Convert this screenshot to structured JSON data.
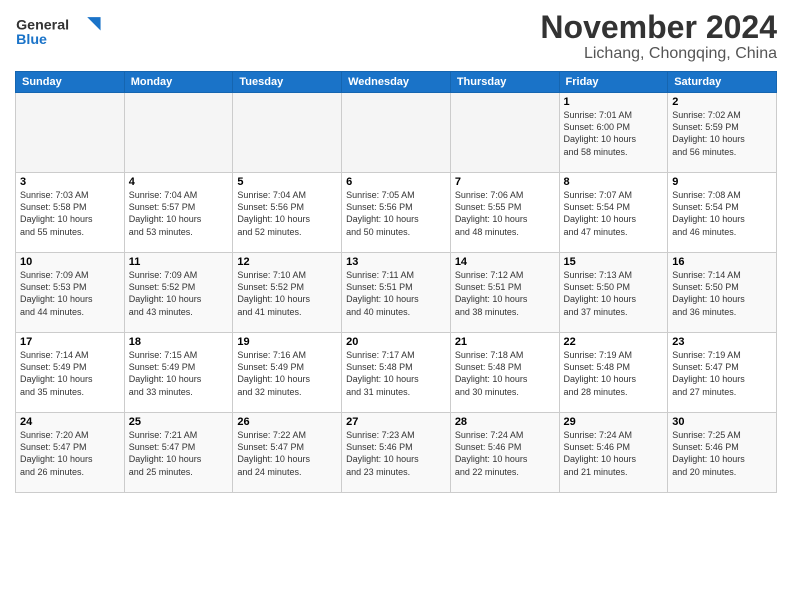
{
  "logo": {
    "general": "General",
    "blue": "Blue"
  },
  "title": "November 2024",
  "subtitle": "Lichang, Chongqing, China",
  "headers": [
    "Sunday",
    "Monday",
    "Tuesday",
    "Wednesday",
    "Thursday",
    "Friday",
    "Saturday"
  ],
  "weeks": [
    [
      {
        "day": "",
        "info": ""
      },
      {
        "day": "",
        "info": ""
      },
      {
        "day": "",
        "info": ""
      },
      {
        "day": "",
        "info": ""
      },
      {
        "day": "",
        "info": ""
      },
      {
        "day": "1",
        "info": "Sunrise: 7:01 AM\nSunset: 6:00 PM\nDaylight: 10 hours\nand 58 minutes."
      },
      {
        "day": "2",
        "info": "Sunrise: 7:02 AM\nSunset: 5:59 PM\nDaylight: 10 hours\nand 56 minutes."
      }
    ],
    [
      {
        "day": "3",
        "info": "Sunrise: 7:03 AM\nSunset: 5:58 PM\nDaylight: 10 hours\nand 55 minutes."
      },
      {
        "day": "4",
        "info": "Sunrise: 7:04 AM\nSunset: 5:57 PM\nDaylight: 10 hours\nand 53 minutes."
      },
      {
        "day": "5",
        "info": "Sunrise: 7:04 AM\nSunset: 5:56 PM\nDaylight: 10 hours\nand 52 minutes."
      },
      {
        "day": "6",
        "info": "Sunrise: 7:05 AM\nSunset: 5:56 PM\nDaylight: 10 hours\nand 50 minutes."
      },
      {
        "day": "7",
        "info": "Sunrise: 7:06 AM\nSunset: 5:55 PM\nDaylight: 10 hours\nand 48 minutes."
      },
      {
        "day": "8",
        "info": "Sunrise: 7:07 AM\nSunset: 5:54 PM\nDaylight: 10 hours\nand 47 minutes."
      },
      {
        "day": "9",
        "info": "Sunrise: 7:08 AM\nSunset: 5:54 PM\nDaylight: 10 hours\nand 46 minutes."
      }
    ],
    [
      {
        "day": "10",
        "info": "Sunrise: 7:09 AM\nSunset: 5:53 PM\nDaylight: 10 hours\nand 44 minutes."
      },
      {
        "day": "11",
        "info": "Sunrise: 7:09 AM\nSunset: 5:52 PM\nDaylight: 10 hours\nand 43 minutes."
      },
      {
        "day": "12",
        "info": "Sunrise: 7:10 AM\nSunset: 5:52 PM\nDaylight: 10 hours\nand 41 minutes."
      },
      {
        "day": "13",
        "info": "Sunrise: 7:11 AM\nSunset: 5:51 PM\nDaylight: 10 hours\nand 40 minutes."
      },
      {
        "day": "14",
        "info": "Sunrise: 7:12 AM\nSunset: 5:51 PM\nDaylight: 10 hours\nand 38 minutes."
      },
      {
        "day": "15",
        "info": "Sunrise: 7:13 AM\nSunset: 5:50 PM\nDaylight: 10 hours\nand 37 minutes."
      },
      {
        "day": "16",
        "info": "Sunrise: 7:14 AM\nSunset: 5:50 PM\nDaylight: 10 hours\nand 36 minutes."
      }
    ],
    [
      {
        "day": "17",
        "info": "Sunrise: 7:14 AM\nSunset: 5:49 PM\nDaylight: 10 hours\nand 35 minutes."
      },
      {
        "day": "18",
        "info": "Sunrise: 7:15 AM\nSunset: 5:49 PM\nDaylight: 10 hours\nand 33 minutes."
      },
      {
        "day": "19",
        "info": "Sunrise: 7:16 AM\nSunset: 5:49 PM\nDaylight: 10 hours\nand 32 minutes."
      },
      {
        "day": "20",
        "info": "Sunrise: 7:17 AM\nSunset: 5:48 PM\nDaylight: 10 hours\nand 31 minutes."
      },
      {
        "day": "21",
        "info": "Sunrise: 7:18 AM\nSunset: 5:48 PM\nDaylight: 10 hours\nand 30 minutes."
      },
      {
        "day": "22",
        "info": "Sunrise: 7:19 AM\nSunset: 5:48 PM\nDaylight: 10 hours\nand 28 minutes."
      },
      {
        "day": "23",
        "info": "Sunrise: 7:19 AM\nSunset: 5:47 PM\nDaylight: 10 hours\nand 27 minutes."
      }
    ],
    [
      {
        "day": "24",
        "info": "Sunrise: 7:20 AM\nSunset: 5:47 PM\nDaylight: 10 hours\nand 26 minutes."
      },
      {
        "day": "25",
        "info": "Sunrise: 7:21 AM\nSunset: 5:47 PM\nDaylight: 10 hours\nand 25 minutes."
      },
      {
        "day": "26",
        "info": "Sunrise: 7:22 AM\nSunset: 5:47 PM\nDaylight: 10 hours\nand 24 minutes."
      },
      {
        "day": "27",
        "info": "Sunrise: 7:23 AM\nSunset: 5:46 PM\nDaylight: 10 hours\nand 23 minutes."
      },
      {
        "day": "28",
        "info": "Sunrise: 7:24 AM\nSunset: 5:46 PM\nDaylight: 10 hours\nand 22 minutes."
      },
      {
        "day": "29",
        "info": "Sunrise: 7:24 AM\nSunset: 5:46 PM\nDaylight: 10 hours\nand 21 minutes."
      },
      {
        "day": "30",
        "info": "Sunrise: 7:25 AM\nSunset: 5:46 PM\nDaylight: 10 hours\nand 20 minutes."
      }
    ]
  ]
}
